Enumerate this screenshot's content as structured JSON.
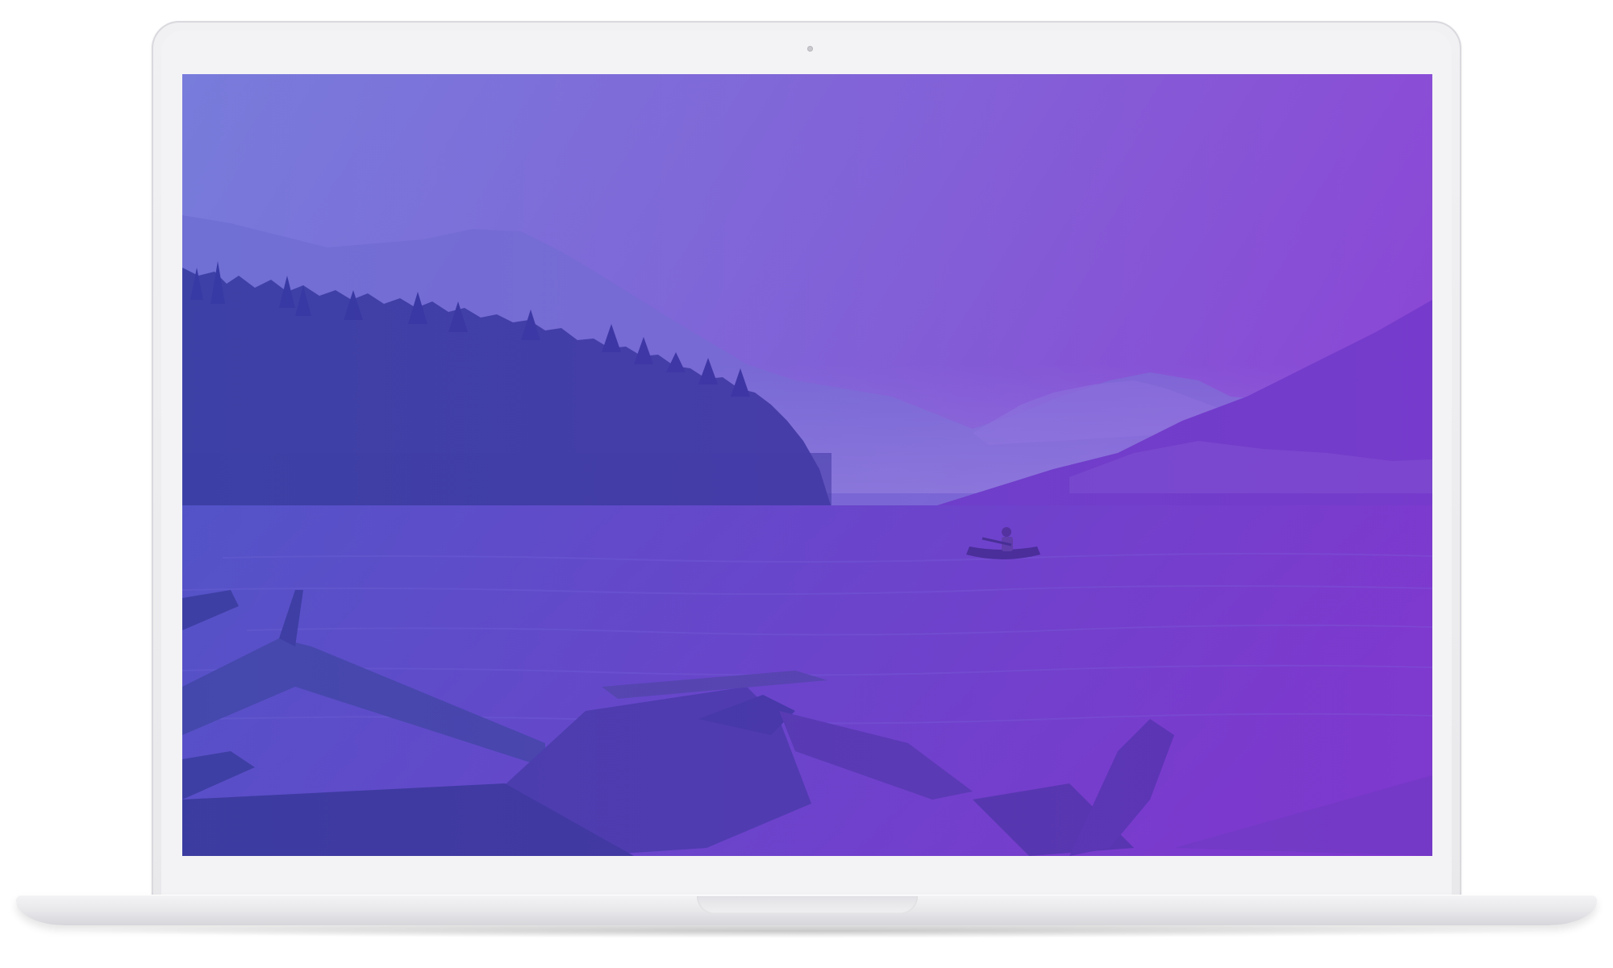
{
  "device": {
    "type": "laptop-mockup",
    "color": "#eeeef1"
  },
  "screen": {
    "content": "wallpaper-photo",
    "scene": [
      "mountains",
      "forest",
      "lake",
      "canoe",
      "driftwood"
    ],
    "overlay_gradient": [
      "#6a5ad6",
      "#8a45d0"
    ]
  }
}
